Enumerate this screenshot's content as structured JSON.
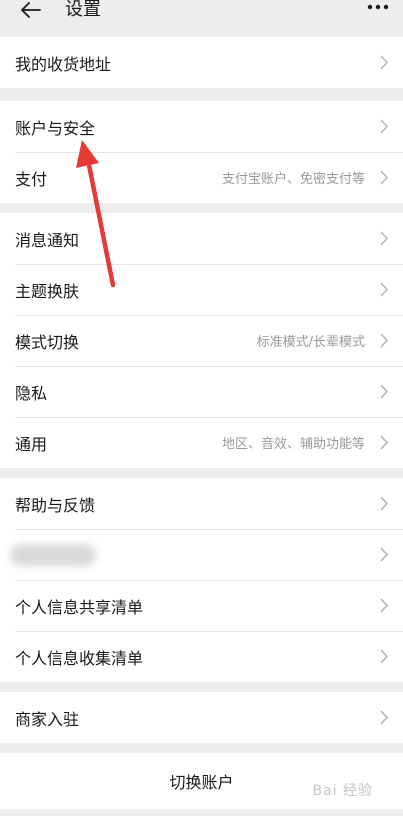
{
  "header": {
    "title": "设置"
  },
  "groups": {
    "g1": [
      {
        "label": "我的收货地址"
      }
    ],
    "g2": [
      {
        "label": "账户与安全"
      },
      {
        "label": "支付",
        "value": "支付宝账户、免密支付等"
      }
    ],
    "g3": [
      {
        "label": "消息通知"
      },
      {
        "label": "主题换肤"
      },
      {
        "label": "模式切换",
        "value": "标准模式/长辈模式"
      },
      {
        "label": "隐私"
      },
      {
        "label": "通用",
        "value": "地区、音效、辅助功能等"
      }
    ],
    "g4": [
      {
        "label": "帮助与反馈"
      },
      {
        "label": "个人信息共享清单"
      },
      {
        "label": "个人信息收集清单"
      }
    ],
    "g5": [
      {
        "label": "商家入驻"
      }
    ]
  },
  "footer": {
    "switch_account": "切换账户"
  },
  "annotation": {
    "arrow_color": "#e53935"
  },
  "watermark": {
    "text": "Bai 经验"
  },
  "icons": {
    "back": "back-arrow-icon",
    "more": "more-dots-icon",
    "chevron": "chevron-right-icon"
  }
}
